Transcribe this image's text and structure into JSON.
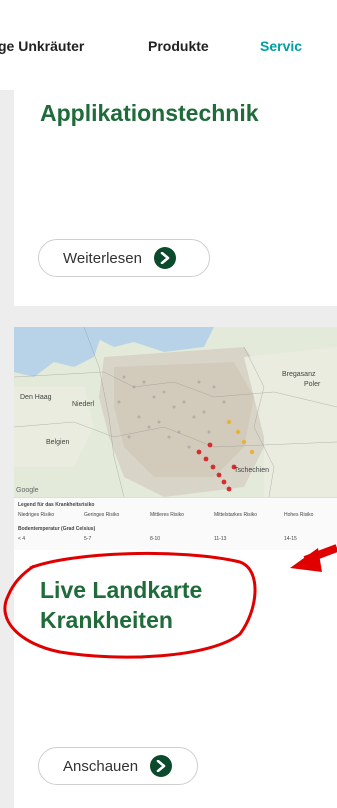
{
  "nav": {
    "items": [
      {
        "label": "ge Unkräuter",
        "active": false
      },
      {
        "label": "Produkte",
        "active": false
      },
      {
        "label": "Servic",
        "active": true
      }
    ]
  },
  "card1": {
    "title": "Applikationstechnik",
    "button_label": "Weiterlesen"
  },
  "card2": {
    "title_line1": "Live Landkarte",
    "title_line2": "Krankheiten",
    "button_label": "Anschauen",
    "map": {
      "labels": [
        "Poler",
        "Niederl",
        "Belgien",
        "Tschechien",
        "Bregasanz",
        "Den Haag",
        "Google"
      ],
      "legend_title_1": "Legend für das Krankheitsrisiko",
      "legend_items_1": [
        "Niedriges Risiko",
        "Geringes Risiko",
        "Mittleres Risiko",
        "Mittelstarkes Risiko",
        "Hohes Risiko"
      ],
      "legend_title_2": "Bodentemperatur (Grad Celsius)",
      "legend_items_2": [
        "< 4",
        "5-7",
        "8-10",
        "11-13",
        "14-15"
      ]
    }
  },
  "colors": {
    "title_green": "#1f6b3a",
    "button_icon": "#0b4a2d",
    "active_nav": "#00a0a0",
    "annotation_red": "#e00000"
  }
}
